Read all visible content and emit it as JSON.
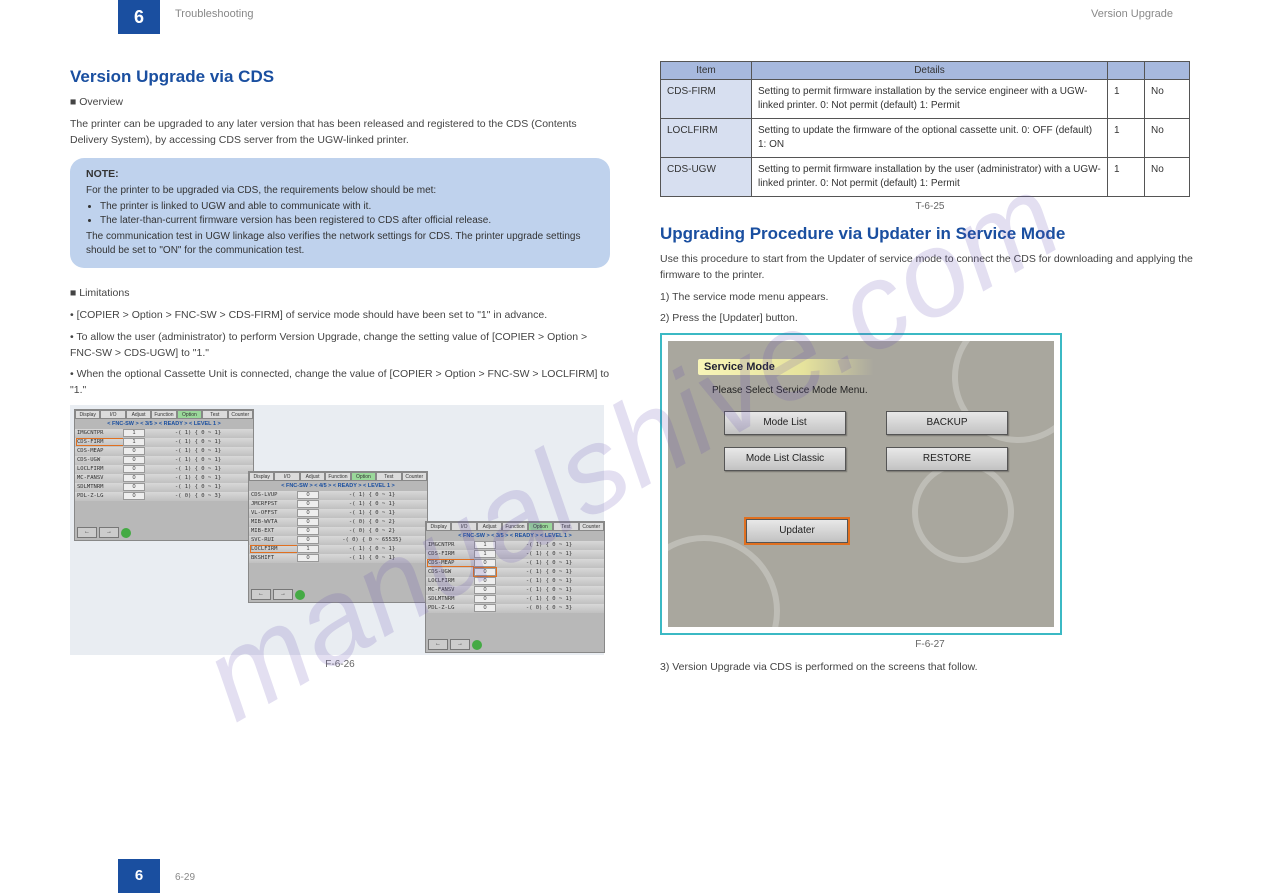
{
  "watermark": "manualshive.com",
  "header": {
    "chapter": "6",
    "chapter_title": "Troubleshooting",
    "section_title": "Version Upgrade"
  },
  "left": {
    "h1": "Version Upgrade via CDS",
    "overview_title": "■ Overview",
    "overview_body": "The printer can be upgraded to any later version that has been released and registered to the CDS (Contents Delivery System), by accessing CDS server from the UGW-linked printer.",
    "note": {
      "title": "NOTE:",
      "intro": "For the printer to be upgraded via CDS, the requirements below should be met:",
      "bullets": [
        "The printer is linked to UGW and able to communicate with it.",
        "The later-than-current firmware version has been registered to CDS after official release."
      ],
      "outro": "The communication test in UGW linkage also verifies the network settings for CDS. The printer upgrade settings should be set to \"ON\" for the communication test."
    },
    "limitations_title": "■ Limitations",
    "limitations_b1": "• [COPIER > Option > FNC-SW > CDS-FIRM] of service mode should have been set to \"1\" in advance.",
    "limitations_b2": "• To allow the user (administrator) to perform Version Upgrade, change the setting value of [COPIER > Option > FNC-SW > CDS-UGW] to \"1.\"",
    "limitations_b3": "• When the optional Cassette Unit is connected, change the value of [COPIER > Option > FNC-SW > LOCLFIRM] to \"1.\"",
    "fig1_cap": "F-6-26"
  },
  "panels": {
    "tabs": [
      "Display",
      "I/O",
      "Adjust",
      "Function",
      "Option",
      "Test",
      "Counter"
    ],
    "range": "-( 1) { 0 ~ 1}",
    "range2": "-( 0) { 0 ~ 2}",
    "range3": "-( 0) { 0 ~ 3}",
    "range65": "-( 0) { 0 ~ 65535}",
    "p1": {
      "path": "< FNC-SW > < 3/5 > < READY > < LEVEL 1 >",
      "rows": [
        {
          "lbl": "IMGCNTPR",
          "val": "1"
        },
        {
          "lbl": "CDS-FIRM",
          "val": "1"
        },
        {
          "lbl": "CDS-MEAP",
          "val": "0"
        },
        {
          "lbl": "CDS-UGW",
          "val": "0"
        },
        {
          "lbl": "LOCLFIRM",
          "val": "0"
        },
        {
          "lbl": "MC-FANSV",
          "val": "0"
        },
        {
          "lbl": "SDLMTNRM",
          "val": "0"
        },
        {
          "lbl": "PDL-Z-LG",
          "val": "0"
        }
      ]
    },
    "p2": {
      "path": "< FNC-SW > < 4/5 > < READY > < LEVEL 1 >",
      "rows": [
        {
          "lbl": "CDS-LVUP",
          "val": "0"
        },
        {
          "lbl": "JMCRFPST",
          "val": "0"
        },
        {
          "lbl": "VL-OFFST",
          "val": "0"
        },
        {
          "lbl": "MIB-WVTA",
          "val": "0"
        },
        {
          "lbl": "MIB-EXT",
          "val": "0"
        },
        {
          "lbl": "SVC-RUI",
          "val": "0"
        },
        {
          "lbl": "LOCLFIRM",
          "val": "1"
        },
        {
          "lbl": "BKSHIFT",
          "val": "0"
        }
      ]
    },
    "p3": {
      "path": "< FNC-SW > < 3/5 > < READY > < LEVEL 1 >",
      "rows": [
        {
          "lbl": "IMGCNTPR",
          "val": "1"
        },
        {
          "lbl": "CDS-FIRM",
          "val": "1"
        },
        {
          "lbl": "CDS-MEAP",
          "val": "0"
        },
        {
          "lbl": "CDS-UGW",
          "val": "0"
        },
        {
          "lbl": "LOCLFIRM",
          "val": "0"
        },
        {
          "lbl": "MC-FANSV",
          "val": "0"
        },
        {
          "lbl": "SDLMTNRM",
          "val": "0"
        },
        {
          "lbl": "PDL-Z-LG",
          "val": "0"
        }
      ]
    }
  },
  "table": {
    "headers": [
      "Item",
      "Details",
      "",
      ""
    ],
    "rows": [
      {
        "item": "CDS-FIRM",
        "details": "Setting to permit firmware installation by the service engineer with a UGW-linked printer.\n0: Not permit (default)\n1: Permit",
        "c3": "1",
        "c4": "No"
      },
      {
        "item": "LOCLFIRM",
        "details": "Setting to update the firmware of the optional cassette unit.\n0: OFF (default)\n1: ON",
        "c3": "1",
        "c4": "No"
      },
      {
        "item": "CDS-UGW",
        "details": "Setting to permit firmware installation by the user (administrator) with a UGW-linked printer.\n0: Not permit (default)\n1: Permit",
        "c3": "1",
        "c4": "No"
      }
    ],
    "caption": "T-6-25"
  },
  "right": {
    "h1": "Upgrading Procedure via Updater in Service Mode",
    "intro": "Use this procedure to start from the Updater of service mode to connect the CDS for downloading and applying the firmware to the printer.",
    "step1": "1) The service mode menu appears.",
    "step2": "2) Press the [Updater] button.",
    "fig2_cap": "F-6-27",
    "step3": "3) Version Upgrade via CDS is performed on the screens that follow."
  },
  "sm": {
    "title": "Service Mode",
    "subtitle": "Please Select Service Mode Menu.",
    "btns": [
      "Mode List",
      "BACKUP",
      "Mode List Classic",
      "RESTORE",
      "Updater"
    ]
  },
  "footer": {
    "page": "6",
    "text": "6-29"
  }
}
